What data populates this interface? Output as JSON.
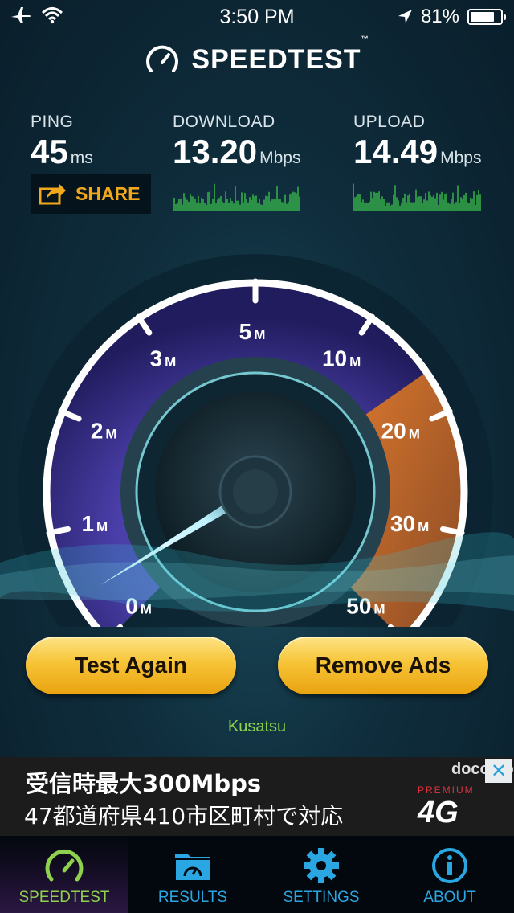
{
  "status_bar": {
    "time": "3:50 PM",
    "battery": "81%",
    "battery_level": 0.81
  },
  "header": {
    "title": "SPEEDTEST",
    "trademark": "™"
  },
  "stats": {
    "ping": {
      "label": "PING",
      "value": "45",
      "unit": "ms"
    },
    "download": {
      "label": "DOWNLOAD",
      "value": "13.20",
      "unit": "Mbps"
    },
    "upload": {
      "label": "UPLOAD",
      "value": "14.49",
      "unit": "Mbps"
    }
  },
  "share": {
    "label": "SHARE"
  },
  "gauge": {
    "ticks": [
      {
        "value": "0",
        "unit": "M"
      },
      {
        "value": "1",
        "unit": "M"
      },
      {
        "value": "2",
        "unit": "M"
      },
      {
        "value": "3",
        "unit": "M"
      },
      {
        "value": "5",
        "unit": "M"
      },
      {
        "value": "10",
        "unit": "M"
      },
      {
        "value": "20",
        "unit": "M"
      },
      {
        "value": "30",
        "unit": "M"
      },
      {
        "value": "50",
        "unit": "M"
      }
    ]
  },
  "buttons": {
    "test_again": "Test Again",
    "remove_ads": "Remove Ads"
  },
  "server": "Kusatsu",
  "ad": {
    "line1": "受信時最大300Mbps",
    "line2": "47都道府県410市区町村で対応",
    "brand": "docomo",
    "premium": "PREMIUM",
    "network": "4G",
    "close": "✕"
  },
  "tabs": [
    {
      "label": "SPEEDTEST",
      "icon": "speedometer-icon",
      "active": true
    },
    {
      "label": "RESULTS",
      "icon": "results-folder-icon",
      "active": false
    },
    {
      "label": "SETTINGS",
      "icon": "gear-icon",
      "active": false
    },
    {
      "label": "ABOUT",
      "icon": "info-icon",
      "active": false
    }
  ],
  "colors": {
    "accent_blue": "#2aa7e2",
    "accent_green": "#8fd14c",
    "share_orange": "#f2a81d",
    "button_gold": "#f7c437"
  }
}
